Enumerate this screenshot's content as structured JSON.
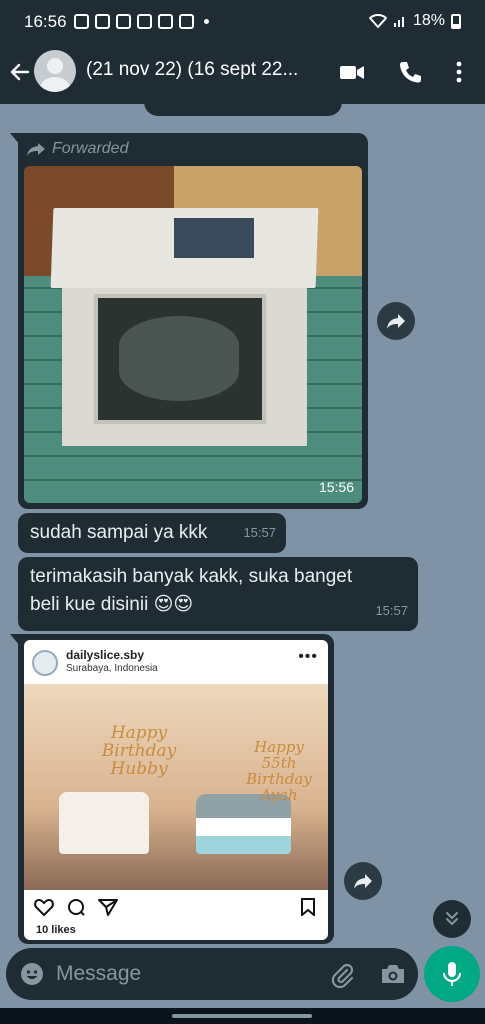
{
  "status_bar": {
    "time": "16:56",
    "battery": "18%"
  },
  "header": {
    "title": "(21 nov 22) (16 sept 22...",
    "icons": [
      "back-arrow-icon",
      "avatar",
      "video-call-icon",
      "voice-call-icon",
      "more-vert-icon"
    ]
  },
  "messages": [
    {
      "type": "image",
      "forwarded_label": "Forwarded",
      "time": "15:56"
    },
    {
      "type": "text",
      "text": "sudah sampai ya kkk",
      "time": "15:57"
    },
    {
      "type": "text",
      "text": "terimakasih banyak kakk, suka banget beli kue disinii 😍😍",
      "time": "15:57"
    },
    {
      "type": "instagram_post",
      "username": "dailyslice.sby",
      "location": "Surabaya, Indonesia",
      "more": "•••",
      "topper_left": "Happy Birthday Hubby",
      "topper_right": "Happy 55th Birthday Ayah",
      "likes": "10 likes"
    }
  ],
  "composer": {
    "placeholder": "Message"
  },
  "colors": {
    "chat_background": "#7f92a6",
    "bubble": "#1f2c34",
    "accent": "#00a884"
  }
}
